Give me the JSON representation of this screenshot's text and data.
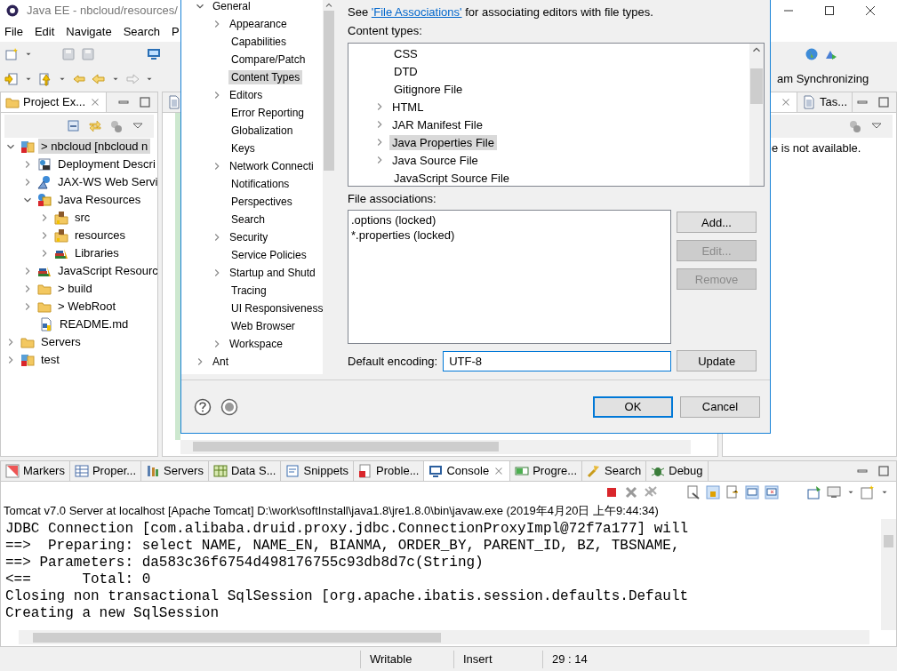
{
  "window": {
    "title": "Java EE - nbcloud/resources/"
  },
  "menu": [
    "File",
    "Edit",
    "Navigate",
    "Search",
    "P"
  ],
  "perspective_bar": {
    "label": "am Synchronizing"
  },
  "project_explorer": {
    "tab": "Project Ex...",
    "tree": [
      {
        "label": "> nbcloud  [nbcloud n",
        "kind": "project",
        "expandable": true,
        "expanded": true,
        "selected": true,
        "children": [
          {
            "label": "Deployment Descri",
            "kind": "descriptor",
            "expandable": true,
            "expanded": false,
            "selected": false
          },
          {
            "label": "JAX-WS Web Servi",
            "kind": "webservice",
            "expandable": true,
            "expanded": false,
            "selected": false
          },
          {
            "label": "Java Resources",
            "kind": "javares",
            "expandable": true,
            "expanded": true,
            "selected": false,
            "children": [
              {
                "label": "src",
                "kind": "package",
                "expandable": true,
                "expanded": false,
                "selected": false
              },
              {
                "label": "resources",
                "kind": "package",
                "expandable": true,
                "expanded": false,
                "selected": false
              },
              {
                "label": "Libraries",
                "kind": "library",
                "expandable": true,
                "expanded": false,
                "selected": false
              }
            ]
          },
          {
            "label": "JavaScript Resourc",
            "kind": "library",
            "expandable": true,
            "expanded": false,
            "selected": false
          },
          {
            "label": "> build",
            "kind": "folder",
            "expandable": true,
            "expanded": false,
            "selected": false
          },
          {
            "label": "> WebRoot",
            "kind": "folder",
            "expandable": true,
            "expanded": false,
            "selected": false
          },
          {
            "label": "README.md",
            "kind": "file",
            "expandable": false,
            "expanded": false,
            "selected": false
          }
        ]
      },
      {
        "label": "Servers",
        "kind": "folder",
        "expandable": true,
        "expanded": false,
        "selected": false
      },
      {
        "label": "test",
        "kind": "project",
        "expandable": true,
        "expanded": false,
        "selected": false
      }
    ]
  },
  "right_panel": {
    "tabs": [
      {
        "label": "Tas...",
        "selected": false
      }
    ],
    "message": "e is not available."
  },
  "preferences": {
    "tree": [
      {
        "label": "General",
        "expandable": true,
        "expanded": true,
        "selected": false,
        "children": [
          {
            "label": "Appearance",
            "expandable": true,
            "expanded": false,
            "selected": false
          },
          {
            "label": "Capabilities",
            "expandable": false,
            "expanded": false,
            "selected": false
          },
          {
            "label": "Compare/Patch",
            "expandable": false,
            "expanded": false,
            "selected": false
          },
          {
            "label": "Content Types",
            "expandable": false,
            "expanded": false,
            "selected": true
          },
          {
            "label": "Editors",
            "expandable": true,
            "expanded": false,
            "selected": false
          },
          {
            "label": "Error Reporting",
            "expandable": false,
            "expanded": false,
            "selected": false
          },
          {
            "label": "Globalization",
            "expandable": false,
            "expanded": false,
            "selected": false
          },
          {
            "label": "Keys",
            "expandable": false,
            "expanded": false,
            "selected": false
          },
          {
            "label": "Network Connecti",
            "expandable": true,
            "expanded": false,
            "selected": false
          },
          {
            "label": "Notifications",
            "expandable": false,
            "expanded": false,
            "selected": false
          },
          {
            "label": "Perspectives",
            "expandable": false,
            "expanded": false,
            "selected": false
          },
          {
            "label": "Search",
            "expandable": false,
            "expanded": false,
            "selected": false
          },
          {
            "label": "Security",
            "expandable": true,
            "expanded": false,
            "selected": false
          },
          {
            "label": "Service Policies",
            "expandable": false,
            "expanded": false,
            "selected": false
          },
          {
            "label": "Startup and Shutd",
            "expandable": true,
            "expanded": false,
            "selected": false
          },
          {
            "label": "Tracing",
            "expandable": false,
            "expanded": false,
            "selected": false
          },
          {
            "label": "UI Responsiveness",
            "expandable": false,
            "expanded": false,
            "selected": false
          },
          {
            "label": "Web Browser",
            "expandable": false,
            "expanded": false,
            "selected": false
          },
          {
            "label": "Workspace",
            "expandable": true,
            "expanded": false,
            "selected": false
          }
        ]
      },
      {
        "label": "Ant",
        "expandable": true,
        "expanded": false,
        "selected": false
      }
    ],
    "intro_before": "See ",
    "link": "'File Associations'",
    "intro_after": " for associating editors with file types.",
    "content_types_label": "Content types:",
    "content_types": [
      {
        "label": "CSS",
        "expandable": false,
        "selected": false
      },
      {
        "label": "DTD",
        "expandable": false,
        "selected": false
      },
      {
        "label": "Gitignore File",
        "expandable": false,
        "selected": false
      },
      {
        "label": "HTML",
        "expandable": true,
        "selected": false
      },
      {
        "label": "JAR Manifest File",
        "expandable": true,
        "selected": false
      },
      {
        "label": "Java Properties File",
        "expandable": true,
        "selected": true
      },
      {
        "label": "Java Source File",
        "expandable": true,
        "selected": false
      },
      {
        "label": "JavaScript Source File",
        "expandable": false,
        "selected": false
      }
    ],
    "associations_label": "File associations:",
    "associations": [
      ".options (locked)",
      "*.properties (locked)"
    ],
    "association_buttons": [
      {
        "label": "Add...",
        "disabled": false
      },
      {
        "label": "Edit...",
        "disabled": true
      },
      {
        "label": "Remove",
        "disabled": true
      }
    ],
    "encoding_label": "Default encoding:",
    "encoding": "UTF-8",
    "update_button": "Update",
    "ok_button": "OK",
    "cancel_button": "Cancel"
  },
  "bottom_tabs": [
    {
      "label": "Markers",
      "kind": "markers",
      "selected": false
    },
    {
      "label": "Proper...",
      "kind": "table",
      "selected": false
    },
    {
      "label": "Servers",
      "kind": "servers",
      "selected": false
    },
    {
      "label": "Data S...",
      "kind": "data",
      "selected": false
    },
    {
      "label": "Snippets",
      "kind": "snippets",
      "selected": false
    },
    {
      "label": "Proble...",
      "kind": "problems",
      "selected": false
    },
    {
      "label": "Console",
      "kind": "console",
      "selected": true
    },
    {
      "label": "Progre...",
      "kind": "progress",
      "selected": false
    },
    {
      "label": "Search",
      "kind": "search",
      "selected": false
    },
    {
      "label": "Debug",
      "kind": "debug",
      "selected": false
    }
  ],
  "console": {
    "header": "Tomcat v7.0 Server at localhost [Apache Tomcat] D:\\work\\softInstall\\java1.8\\jre1.8.0\\bin\\javaw.exe (2019年4月20日 上午9:44:34)",
    "lines": [
      "JDBC Connection [com.alibaba.druid.proxy.jdbc.ConnectionProxyImpl@72f7a177] will",
      "==>  Preparing: select NAME, NAME_EN, BIANMA, ORDER_BY, PARENT_ID, BZ, TBSNAME,",
      "==> Parameters: da583c36f6754d498176755c93db8d7c(String)",
      "<==      Total: 0",
      "Closing non transactional SqlSession [org.apache.ibatis.session.defaults.Default",
      "Creating a new SqlSession"
    ]
  },
  "status_bar": [
    "Writable",
    "Insert",
    "29 : 14"
  ]
}
